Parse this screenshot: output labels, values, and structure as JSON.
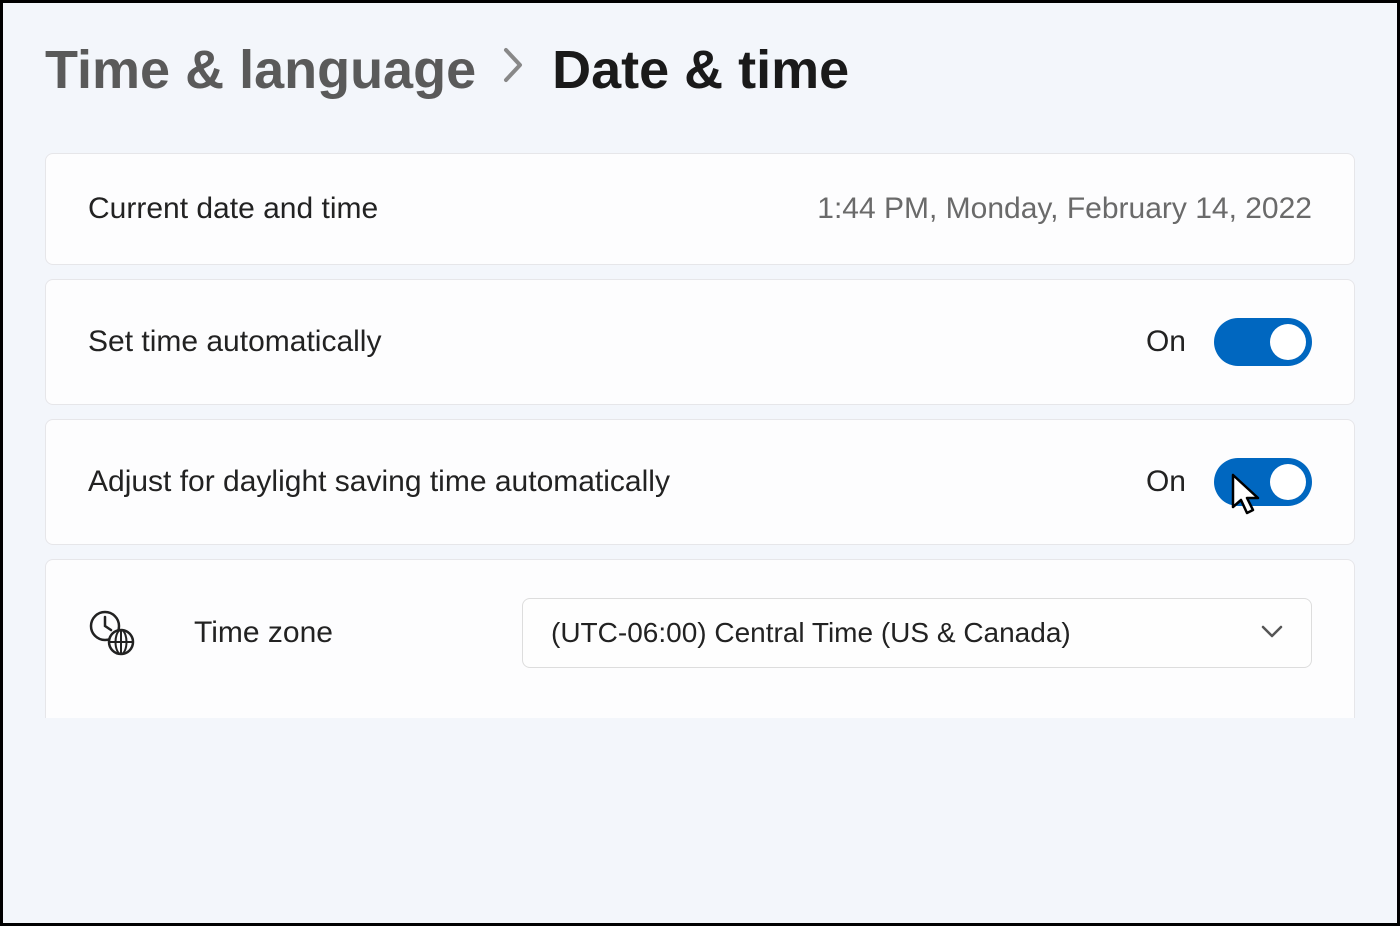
{
  "breadcrumb": {
    "parent": "Time & language",
    "current": "Date & time"
  },
  "currentDate": {
    "label": "Current date and time",
    "value": "1:44 PM, Monday, February 14, 2022"
  },
  "setTimeAuto": {
    "label": "Set time automatically",
    "state": "On"
  },
  "dstAuto": {
    "label": "Adjust for daylight saving time automatically",
    "state": "On"
  },
  "timezone": {
    "label": "Time zone",
    "value": "(UTC-06:00) Central Time (US & Canada)"
  }
}
